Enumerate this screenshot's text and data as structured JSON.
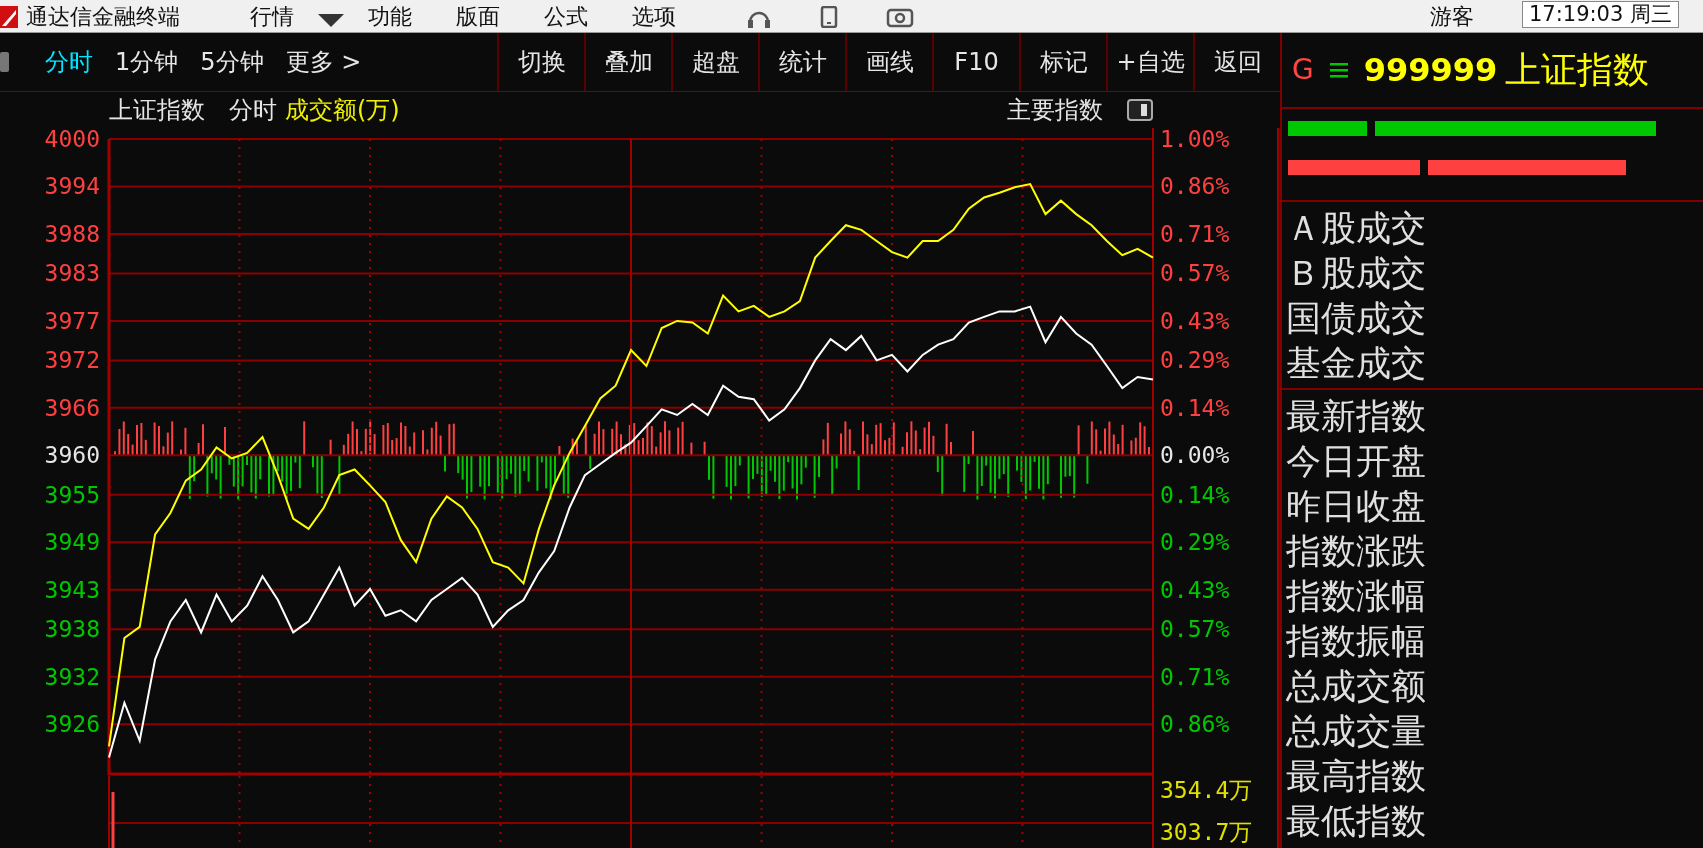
{
  "window": {
    "title": "通达信金融终端"
  },
  "menu": [
    "行情",
    "功能",
    "版面",
    "公式",
    "选项"
  ],
  "user": "游客",
  "clock": "17:19:03 周三",
  "toolbar": {
    "periods": [
      {
        "label": "分时",
        "selected": true
      },
      {
        "label": "1分钟",
        "selected": false
      },
      {
        "label": "5分钟",
        "selected": false
      },
      {
        "label": "更多 >",
        "selected": false
      }
    ],
    "buttons": [
      "切换",
      "叠加",
      "超盘",
      "统计",
      "画线",
      "F10",
      "标记",
      "+自选",
      "返回"
    ]
  },
  "chart_header": {
    "title": "上证指数",
    "mode": "分时",
    "indicator": "成交额(万)",
    "index_group": "主要指数"
  },
  "chart": {
    "chart_data": {
      "type": "line",
      "ylim": [
        3919.7,
        4000
      ],
      "grid": true,
      "yticks": [
        {
          "value": 4000,
          "label": "4000"
        },
        {
          "value": 3994,
          "label": "3994"
        },
        {
          "value": 3988,
          "label": "3988"
        },
        {
          "value": 3983,
          "label": "3983"
        },
        {
          "value": 3977,
          "label": "3977"
        },
        {
          "value": 3972,
          "label": "3972"
        },
        {
          "value": 3966,
          "label": "3966"
        },
        {
          "value": 3960,
          "label": "3960"
        },
        {
          "value": 3955,
          "label": "3955"
        },
        {
          "value": 3949,
          "label": "3949"
        },
        {
          "value": 3943,
          "label": "3943"
        },
        {
          "value": 3938,
          "label": "3938"
        },
        {
          "value": 3932,
          "label": "3932"
        },
        {
          "value": 3926,
          "label": "3926"
        }
      ],
      "series": [
        {
          "color": "#ffffff",
          "values": [
            3921.8,
            3928.7,
            3923.9,
            3934.2,
            3939,
            3941.7,
            3937.6,
            3942.4,
            3939,
            3941,
            3944.7,
            3941.7,
            3937.6,
            3939,
            3942.4,
            3945.8,
            3941,
            3943.1,
            3939.7,
            3940.4,
            3939,
            3941.7,
            3943.1,
            3944.5,
            3942.4,
            3938.3,
            3940.4,
            3941.7,
            3945.2,
            3947.9,
            3953.4,
            3957.5,
            3958.9,
            3960.3,
            3961.6,
            3963.7,
            3965.8,
            3965.1,
            3966.5,
            3965.1,
            3968.8,
            3967.4,
            3967.1,
            3964.4,
            3965.8,
            3968.5,
            3972,
            3974.7,
            3973.3,
            3975.1,
            3972,
            3972.7,
            3970.6,
            3972.7,
            3974,
            3974.7,
            3976.8,
            3977.5,
            3978.2,
            3978.2,
            3978.8,
            3974.3,
            3977.5,
            3975.4,
            3974,
            3971.3,
            3968.5,
            3969.9,
            3969.6
          ]
        },
        {
          "color": "#ffff00",
          "values": [
            3923.2,
            3936.9,
            3938.3,
            3950,
            3952.7,
            3956.8,
            3958.2,
            3961,
            3959.6,
            3960.3,
            3962.3,
            3957.5,
            3952,
            3950.7,
            3953.4,
            3957.5,
            3958.2,
            3956.2,
            3954.1,
            3949.3,
            3946.5,
            3952,
            3954.8,
            3953.4,
            3950.7,
            3946.5,
            3945.8,
            3943.8,
            3950.7,
            3956.2,
            3960.3,
            3963.7,
            3967.2,
            3968.8,
            3973.3,
            3971.3,
            3976.1,
            3977,
            3976.8,
            3975.4,
            3980.2,
            3978.2,
            3978.9,
            3977.5,
            3978.2,
            3979.5,
            3985,
            3987.1,
            3989.1,
            3988.5,
            3987.1,
            3985.7,
            3985,
            3987.1,
            3987.1,
            3988.5,
            3991.2,
            3992.6,
            3993.2,
            3993.9,
            3994.3,
            3990.5,
            3992.2,
            3990.5,
            3989.1,
            3987.1,
            3985.3,
            3986.1,
            3985
          ]
        }
      ]
    },
    "percent_labels": [
      {
        "text": "1.00%",
        "color": "#ff4040"
      },
      {
        "text": "0.86%",
        "color": "#ff4040"
      },
      {
        "text": "0.71%",
        "color": "#ff4040"
      },
      {
        "text": "0.57%",
        "color": "#ff4040"
      },
      {
        "text": "0.43%",
        "color": "#ff4040"
      },
      {
        "text": "0.29%",
        "color": "#ff4040"
      },
      {
        "text": "0.14%",
        "color": "#ff4040"
      },
      {
        "text": "0.00%",
        "color": "#e6e6e6"
      },
      {
        "text": "0.14%",
        "color": "#00c800"
      },
      {
        "text": "0.29%",
        "color": "#00c800"
      },
      {
        "text": "0.43%",
        "color": "#00c800"
      },
      {
        "text": "0.57%",
        "color": "#00c800"
      },
      {
        "text": "0.71%",
        "color": "#00c800"
      },
      {
        "text": "0.86%",
        "color": "#00c800"
      }
    ],
    "volume_labels": [
      "354.4万",
      "303.7万"
    ]
  },
  "quote_panel": {
    "market": "G",
    "code": "999999",
    "name": "上证指数",
    "turnover_rows": [
      "Ａ股成交",
      "Ｂ股成交",
      "国债成交",
      "基金成交"
    ],
    "stat_rows": [
      "最新指数",
      "今日开盘",
      "昨日收盘",
      "指数涨跌",
      "指数涨幅",
      "指数振幅",
      "总成交额",
      "总成交量",
      "最高指数",
      "最低指数"
    ]
  }
}
